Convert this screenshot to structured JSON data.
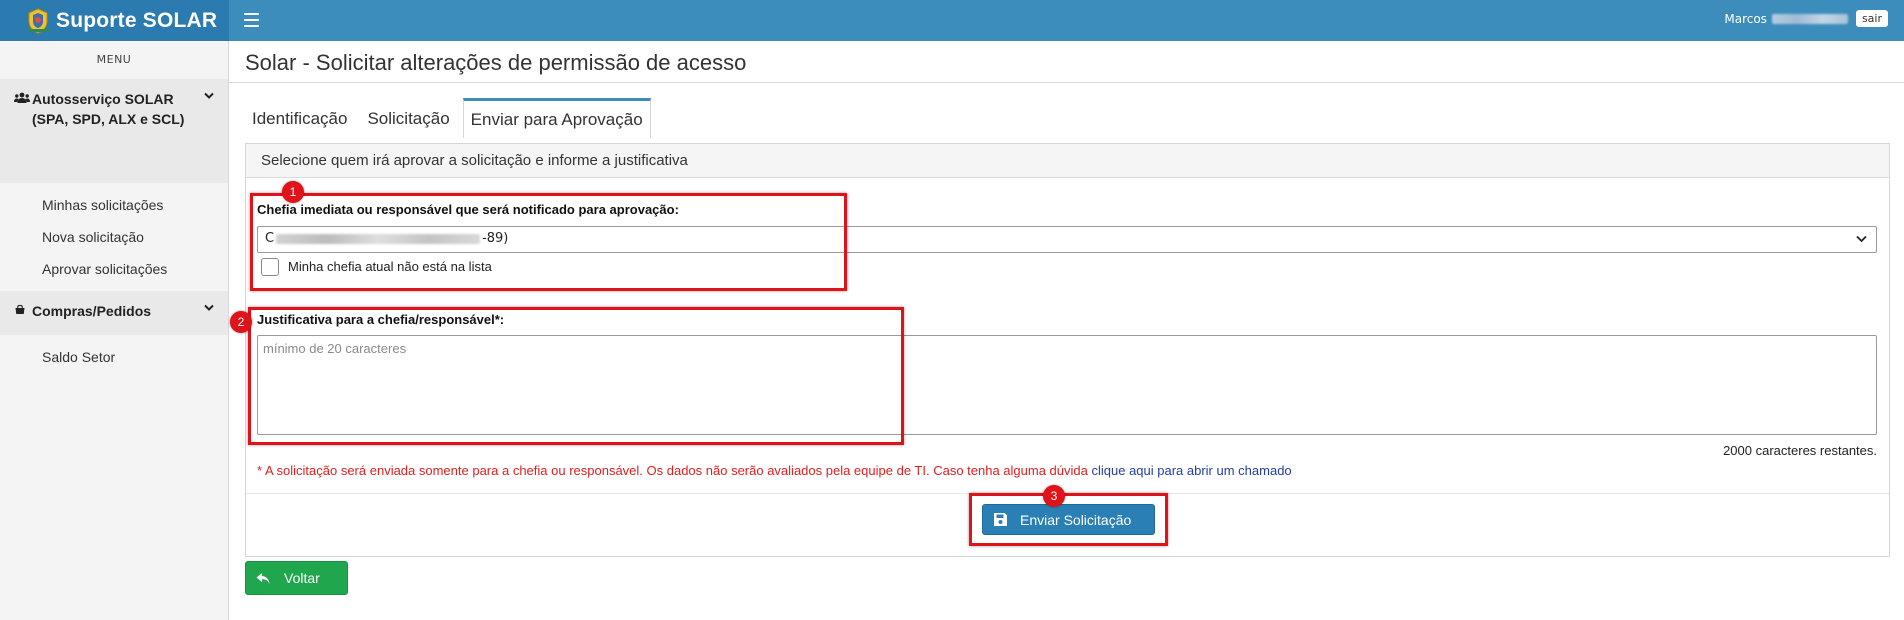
{
  "app": {
    "brand": "Suporte SOLAR"
  },
  "header": {
    "user_name": "Marcos",
    "logout_label": "sair"
  },
  "sidebar": {
    "menu_label": "MENU",
    "groups": [
      {
        "label": "Autosserviço SOLAR (SPA, SPD, ALX e SCL)",
        "icon": "users-icon",
        "items": [
          {
            "label": "Minhas solicitações"
          },
          {
            "label": "Nova solicitação"
          },
          {
            "label": "Aprovar solicitações"
          }
        ]
      },
      {
        "label": "Compras/Pedidos",
        "icon": "shopping-bag-icon",
        "items": [
          {
            "label": "Saldo Setor"
          }
        ]
      }
    ]
  },
  "page": {
    "title": "Solar - Solicitar alterações de permissão de acesso",
    "tabs": [
      {
        "label": "Identificação"
      },
      {
        "label": "Solicitação"
      },
      {
        "label": "Enviar para Aprovação",
        "active": true
      }
    ]
  },
  "form": {
    "panel_title": "Selecione quem irá aprovar a solicitação e informe a justificativa",
    "supervisor_label": "Chefia imediata ou responsável que será notificado para aprovação:",
    "supervisor_value_prefix": "C",
    "supervisor_value_suffix": "-89)",
    "not_in_list_label": "Minha chefia atual não está na lista",
    "justification_label": "Justificativa para a chefia/responsável*:",
    "justification_placeholder": "mínimo de 20 caracteres",
    "chars_remaining": "2000 caracteres restantes.",
    "notice_text": "* A solicitação será enviada somente para a chefia ou responsável. Os dados não serão avaliados pela equipe de TI. Caso tenha alguma dúvida ",
    "notice_link": "clique aqui para abrir um chamado",
    "submit_label": "Enviar Solicitação",
    "back_label": "Voltar"
  },
  "annotations": [
    {
      "label": "1"
    },
    {
      "label": "2"
    },
    {
      "label": "3"
    }
  ],
  "colors": {
    "header": "#3c8dbc",
    "brand": "#2b7bb0",
    "primary_button": "#2a80b4",
    "success_button": "#20a64d",
    "annotation": "#e0121a",
    "notice": "#e02020"
  }
}
